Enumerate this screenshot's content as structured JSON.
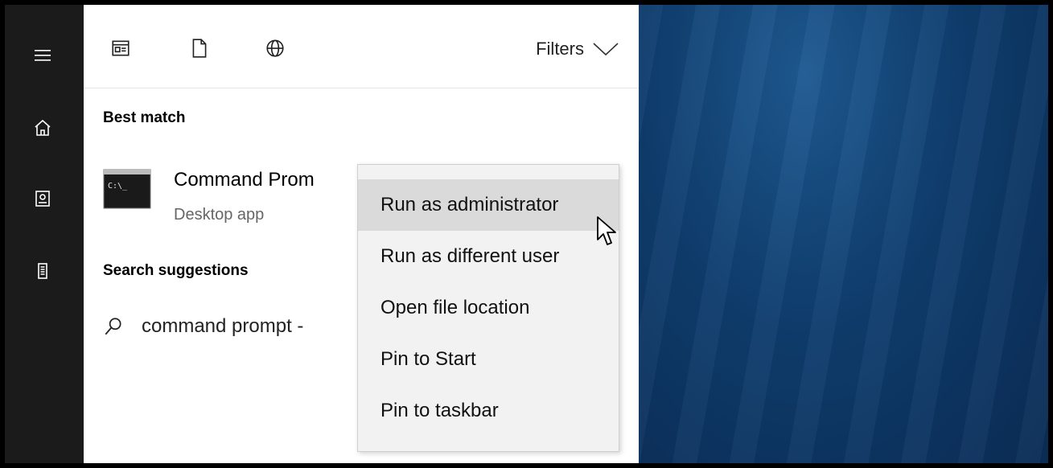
{
  "rail": {
    "items": [
      {
        "icon": "hamburger-icon"
      },
      {
        "icon": "home-icon"
      },
      {
        "icon": "notebook-icon"
      },
      {
        "icon": "device-icon"
      }
    ]
  },
  "topbar": {
    "icons": [
      "apps-icon",
      "documents-icon",
      "web-icon"
    ],
    "filters_label": "Filters"
  },
  "best_match": {
    "label": "Best match",
    "title": "Command Prom",
    "subtitle": "Desktop app"
  },
  "suggestions": {
    "label": "Search suggestions",
    "items": [
      {
        "text": "command prompt -"
      }
    ]
  },
  "context_menu": {
    "items": [
      {
        "label": "Run as administrator",
        "hover": true
      },
      {
        "label": "Run as different user"
      },
      {
        "label": "Open file location"
      },
      {
        "label": "Pin to Start"
      },
      {
        "label": "Pin to taskbar"
      }
    ]
  },
  "colors": {
    "rail_bg": "#1b1b1b",
    "panel_bg": "#ffffff",
    "menu_bg": "#f2f2f2",
    "menu_hover": "#dadada",
    "desktop_blue": "#0f3d6e"
  }
}
